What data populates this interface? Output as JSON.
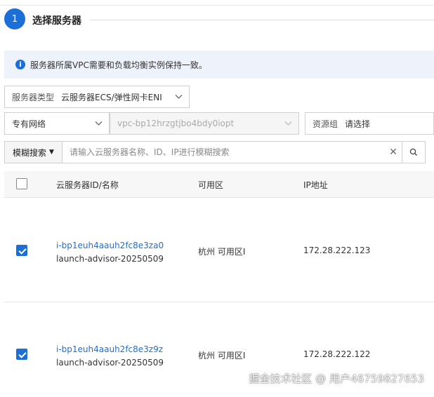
{
  "step": {
    "number": "1",
    "title": "选择服务器"
  },
  "notice": {
    "icon": "info-icon",
    "text": "服务器所属VPC需要和负载均衡实例保持一致。"
  },
  "filters": {
    "server_type": {
      "label": "服务器类型",
      "value": "云服务器ECS/弹性网卡ENI"
    },
    "network": {
      "value": "专有网络"
    },
    "vpc": {
      "value": "vpc-bp12hrzgtjbo4bdy0iopt"
    },
    "resource_group": {
      "label": "资源组",
      "value": "请选择"
    }
  },
  "search": {
    "mode": "模糊搜索",
    "placeholder": "请输入云服务器名称、ID、IP进行模糊搜索"
  },
  "table": {
    "columns": [
      "云服务器ID/名称",
      "可用区",
      "IP地址"
    ],
    "rows": [
      {
        "checked": true,
        "id": "i-bp1euh4aauh2fc8e3za0",
        "name": "launch-advisor-20250509",
        "zone": "杭州 可用区I",
        "ip": "172.28.222.123"
      },
      {
        "checked": true,
        "id": "i-bp1euh4aauh2fc8e3z9z",
        "name": "launch-advisor-20250509",
        "zone": "杭州 可用区I",
        "ip": "172.28.222.122"
      }
    ]
  },
  "watermark": "掘金技术社区 @ 用户46759827653",
  "colors": {
    "accent": "#1c6fd6",
    "info_bg": "#eef3fb"
  }
}
